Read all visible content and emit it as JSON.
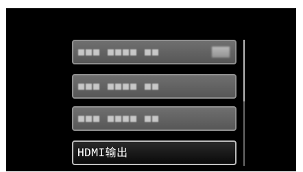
{
  "menu": {
    "items": [
      {
        "label": "",
        "has_icon": true,
        "selected": false
      },
      {
        "label": "",
        "has_icon": false,
        "selected": false
      },
      {
        "label": "",
        "has_icon": false,
        "selected": false
      },
      {
        "label": "HDMI输出",
        "has_icon": false,
        "selected": true
      }
    ]
  },
  "scrollbar": {
    "position_fraction": 0.0
  }
}
